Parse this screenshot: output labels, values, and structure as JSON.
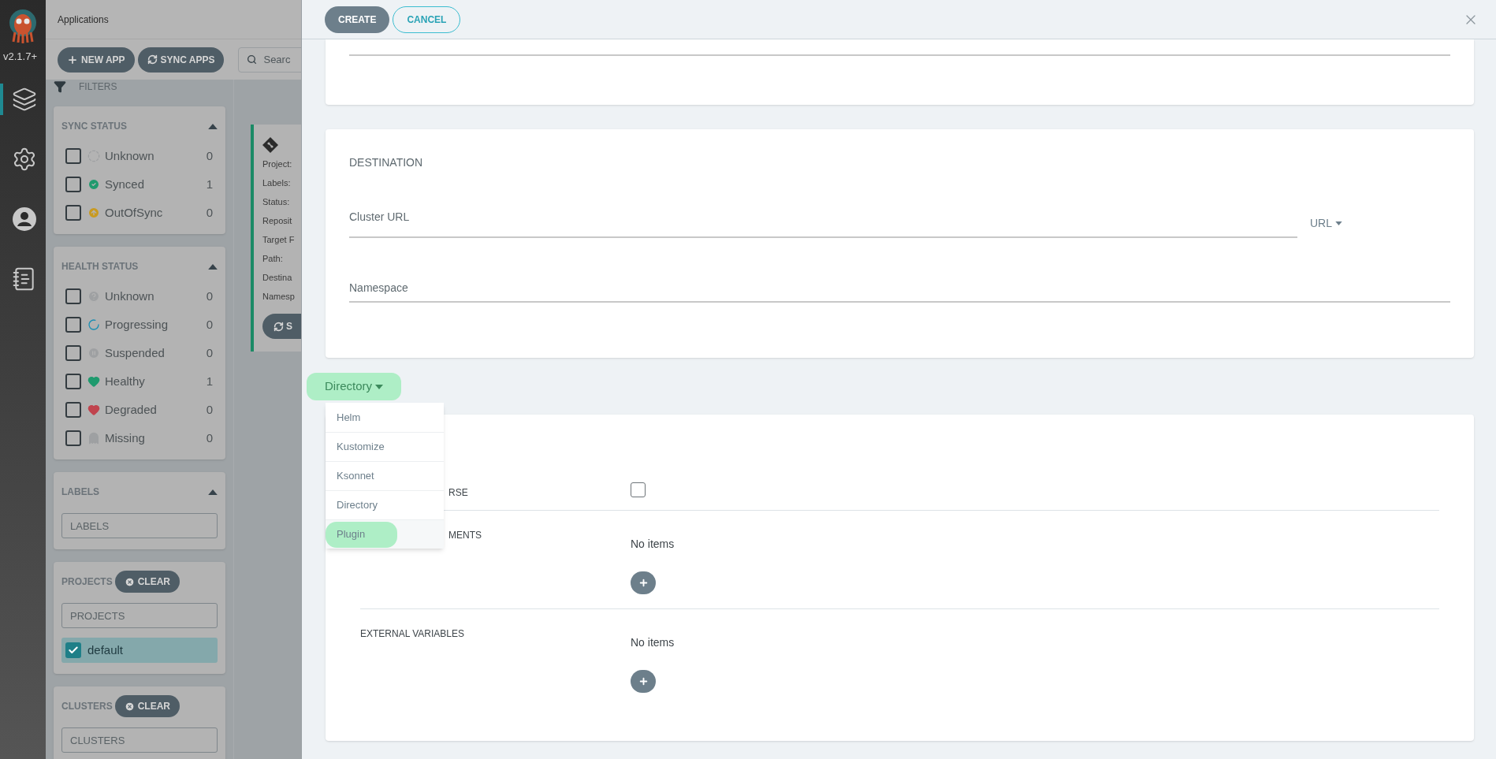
{
  "nav": {
    "version": "v2.1.7+",
    "items": [
      {
        "kind": "layers",
        "selected": true
      },
      {
        "kind": "settings",
        "selected": false
      },
      {
        "kind": "user",
        "selected": false
      },
      {
        "kind": "docs",
        "selected": false
      }
    ]
  },
  "header": {
    "title": "Applications"
  },
  "toolbar": {
    "buttons": [
      {
        "kind": "add",
        "label": "NEW APP"
      },
      {
        "kind": "sync",
        "label": "SYNC APPS"
      }
    ],
    "search": {
      "placeholder": "Searc"
    }
  },
  "filters": {
    "title": "FILTERS",
    "sections": [
      {
        "kind": "checklist",
        "title": "SYNC STATUS",
        "expanded": true,
        "items": [
          {
            "kind": "unknown-sync",
            "label": "Unknown",
            "count": "0",
            "checked": false
          },
          {
            "kind": "synced",
            "label": "Synced",
            "count": "1",
            "checked": false
          },
          {
            "kind": "outofsync",
            "label": "OutOfSync",
            "count": "0",
            "checked": false
          }
        ]
      },
      {
        "kind": "checklist",
        "title": "HEALTH STATUS",
        "expanded": true,
        "items": [
          {
            "kind": "unknown-health",
            "label": "Unknown",
            "count": "0",
            "checked": false
          },
          {
            "kind": "progressing",
            "label": "Progressing",
            "count": "0",
            "checked": false
          },
          {
            "kind": "suspended",
            "label": "Suspended",
            "count": "0",
            "checked": false
          },
          {
            "kind": "healthy",
            "label": "Healthy",
            "count": "1",
            "checked": false
          },
          {
            "kind": "degraded",
            "label": "Degraded",
            "count": "0",
            "checked": false
          },
          {
            "kind": "missing",
            "label": "Missing",
            "count": "0",
            "checked": false
          }
        ]
      },
      {
        "kind": "field",
        "title": "LABELS",
        "expanded": true,
        "placeholder": "LABELS"
      },
      {
        "kind": "clearable",
        "title": "PROJECTS",
        "clear": "CLEAR",
        "placeholder": "PROJECTS",
        "options": [
          {
            "label": "default",
            "checked": true
          }
        ]
      },
      {
        "kind": "clearable",
        "title": "CLUSTERS",
        "clear": "CLEAR",
        "placeholder": "CLUSTERS"
      }
    ]
  },
  "app_card": {
    "fields": [
      "Project:",
      "Labels:",
      "Status:",
      "Reposit",
      "Target F",
      "Path:",
      "Destina",
      "Namesp"
    ],
    "button": "S"
  },
  "panel": {
    "buttons": [
      {
        "kind": "primary",
        "label": "CREATE"
      },
      {
        "kind": "outline",
        "label": "CANCEL"
      }
    ],
    "destination": {
      "title": "DESTINATION",
      "cluster_url": {
        "placeholder": "Cluster URL"
      },
      "url_mode": "URL",
      "namespace": {
        "placeholder": "Namespace"
      }
    },
    "source_type": {
      "value": "Directory",
      "expanded": true,
      "options": [
        {
          "label": "Helm",
          "highlighted": false
        },
        {
          "label": "Kustomize",
          "highlighted": false
        },
        {
          "label": "Ksonnet",
          "highlighted": false
        },
        {
          "label": "Directory",
          "highlighted": false
        },
        {
          "label": "Plugin",
          "highlighted": true
        }
      ]
    },
    "directory": {
      "rows": [
        {
          "kind": "checkbox",
          "label": "RSE",
          "checked": false
        },
        {
          "kind": "list",
          "label": "MENTS",
          "empty": "No items"
        },
        {
          "kind": "list",
          "label": "EXTERNAL VARIABLES",
          "empty": "No items"
        }
      ]
    }
  }
}
